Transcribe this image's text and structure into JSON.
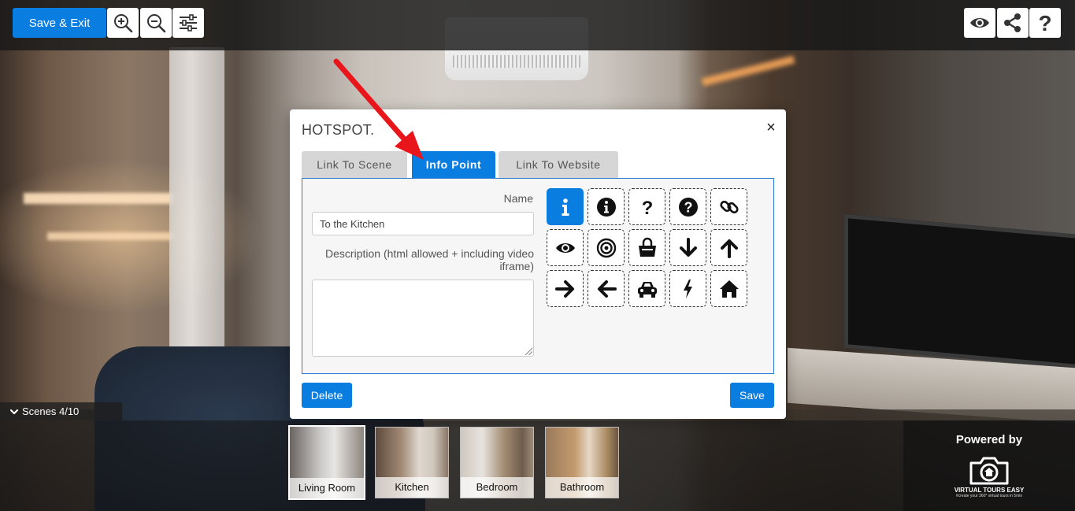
{
  "toolbar": {
    "save_exit_label": "Save & Exit",
    "tools_left": [
      {
        "name": "zoom-in",
        "icon": "zoom-in-icon"
      },
      {
        "name": "zoom-out",
        "icon": "zoom-out-icon"
      },
      {
        "name": "settings",
        "icon": "sliders-icon"
      }
    ],
    "tools_right": [
      {
        "name": "preview",
        "icon": "eye-icon"
      },
      {
        "name": "share",
        "icon": "share-icon"
      },
      {
        "name": "help",
        "icon": "question-icon"
      }
    ]
  },
  "modal": {
    "title": "HOTSPOT.",
    "close_symbol": "×",
    "tabs": [
      {
        "label": "Link To Scene",
        "active": false
      },
      {
        "label": "Info Point",
        "active": true
      },
      {
        "label": "Link To Website",
        "active": false
      }
    ],
    "form": {
      "name_label": "Name",
      "name_value": "To the Kitchen",
      "description_label": "Description (html allowed + including video iframe)",
      "description_value": ""
    },
    "icons": [
      {
        "name": "info-icon",
        "selected": true
      },
      {
        "name": "info-circle-icon",
        "selected": false
      },
      {
        "name": "question-icon",
        "selected": false
      },
      {
        "name": "question-circle-icon",
        "selected": false
      },
      {
        "name": "link-icon",
        "selected": false
      },
      {
        "name": "eye-icon",
        "selected": false
      },
      {
        "name": "target-icon",
        "selected": false
      },
      {
        "name": "shopping-bag-icon",
        "selected": false
      },
      {
        "name": "arrow-down-icon",
        "selected": false
      },
      {
        "name": "arrow-up-icon",
        "selected": false
      },
      {
        "name": "arrow-right-icon",
        "selected": false
      },
      {
        "name": "arrow-left-icon",
        "selected": false
      },
      {
        "name": "car-icon",
        "selected": false
      },
      {
        "name": "bolt-icon",
        "selected": false
      },
      {
        "name": "home-icon",
        "selected": false
      }
    ],
    "delete_label": "Delete",
    "save_label": "Save"
  },
  "scenes": {
    "toggle_label": "Scenes 4/10",
    "items": [
      {
        "label": "Living Room",
        "current": true
      },
      {
        "label": "Kitchen",
        "current": false
      },
      {
        "label": "Bedroom",
        "current": false
      },
      {
        "label": "Bathroom",
        "current": false
      }
    ]
  },
  "branding": {
    "powered_by": "Powered by",
    "logo_text": "VIRTUAL TOURS EASY",
    "logo_tagline": "#create your 360° virtual tours in 5min"
  },
  "colors": {
    "accent": "#0a7de0",
    "annotation_arrow": "#e8161b"
  }
}
